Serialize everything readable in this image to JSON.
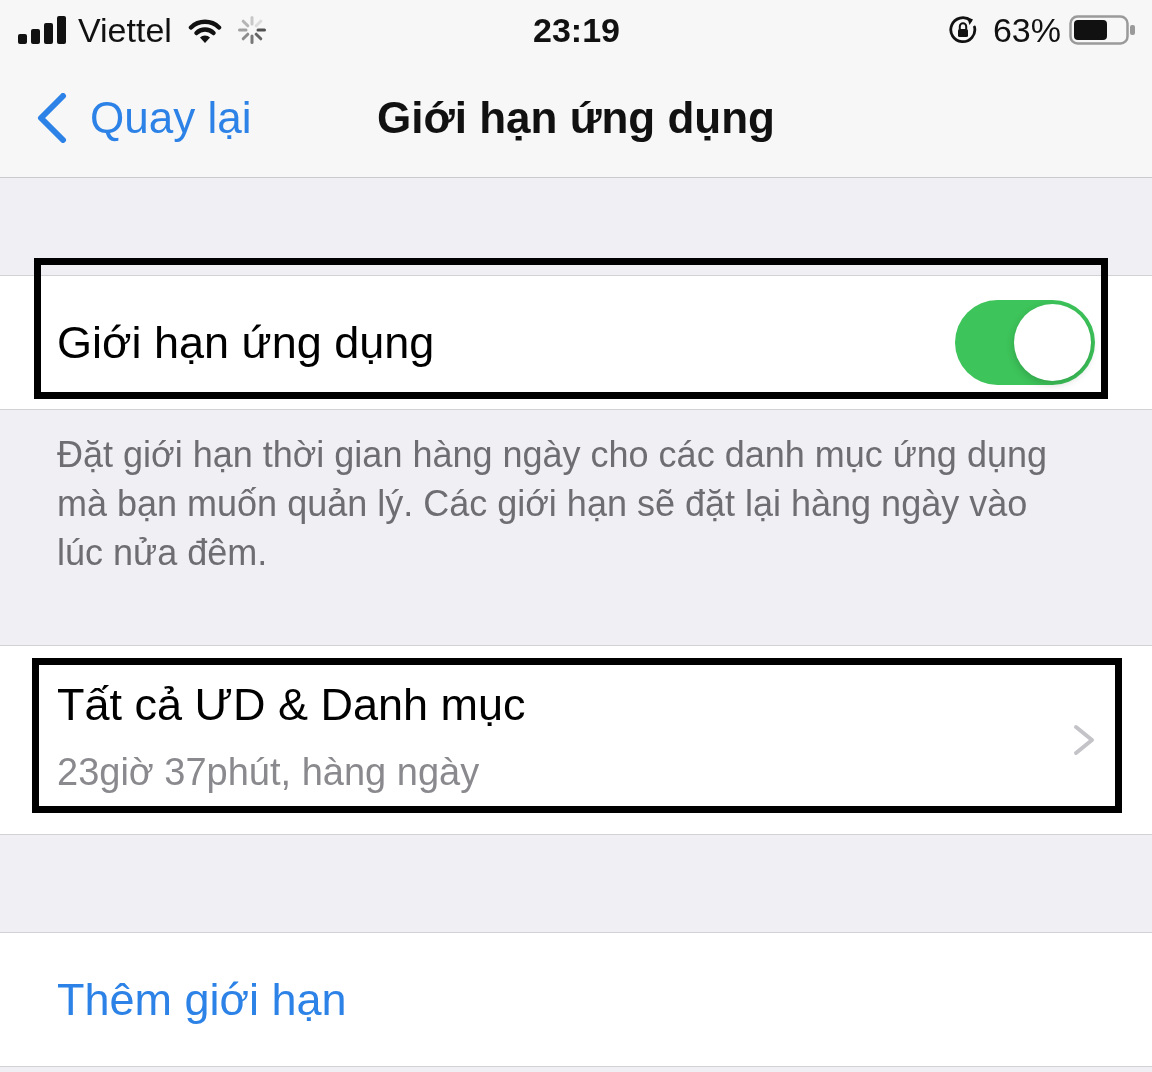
{
  "status_bar": {
    "carrier": "Viettel",
    "time": "23:19",
    "battery": "63%"
  },
  "nav_bar": {
    "back": "Quay lại",
    "title": "Giới hạn ứng dụng"
  },
  "sections": [
    {
      "rows": [
        {
          "kind": "toggle",
          "label": "Giới hạn ứng dụng",
          "on": true,
          "highlighted": true
        }
      ],
      "footer": "Đặt giới hạn thời gian hàng ngày cho các danh mục ứng dụng mà bạn muốn quản lý. Các giới hạn sẽ đặt lại hàng ngày vào lúc nửa đêm."
    },
    {
      "rows": [
        {
          "kind": "detail",
          "label": "Tất cả ƯD & Danh mục",
          "subtitle": "23giờ 37phút, hàng ngày",
          "highlighted": true
        }
      ]
    },
    {
      "rows": [
        {
          "kind": "action",
          "label": "Thêm giới hạn",
          "highlighted": false
        }
      ]
    }
  ]
}
